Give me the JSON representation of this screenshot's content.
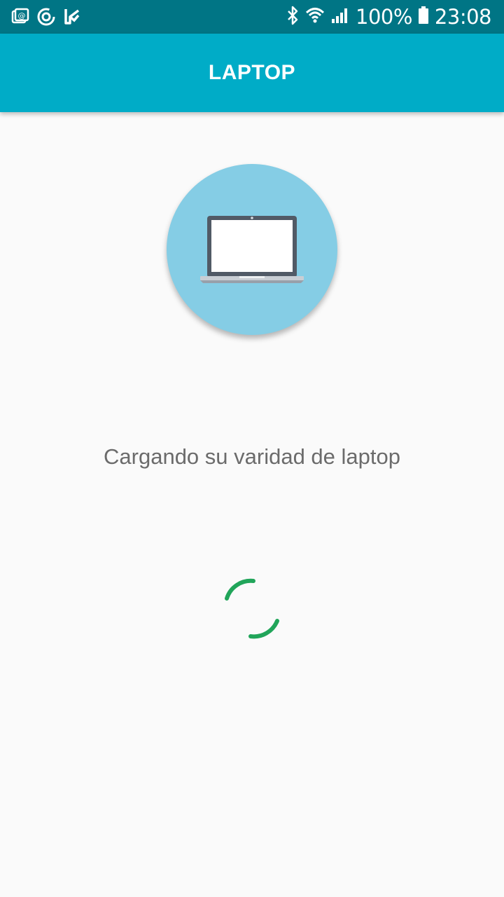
{
  "status_bar": {
    "battery": "100%",
    "time": "23:08",
    "left_icons": [
      "gallery-email-icon",
      "sync-circle-icon",
      "check-flag-icon"
    ],
    "right_icons": [
      "bluetooth-icon",
      "wifi-icon",
      "signal-icon",
      "battery-icon"
    ]
  },
  "app_bar": {
    "title": "LAPTOP"
  },
  "main": {
    "hero_icon": "laptop-icon",
    "loading_text": "Cargando su varidad de laptop",
    "spinner_color": "#21a55a"
  },
  "colors": {
    "status_bar": "#007585",
    "app_bar": "#00acc7",
    "hero_circle": "#85cde5",
    "background": "#fafafa"
  }
}
